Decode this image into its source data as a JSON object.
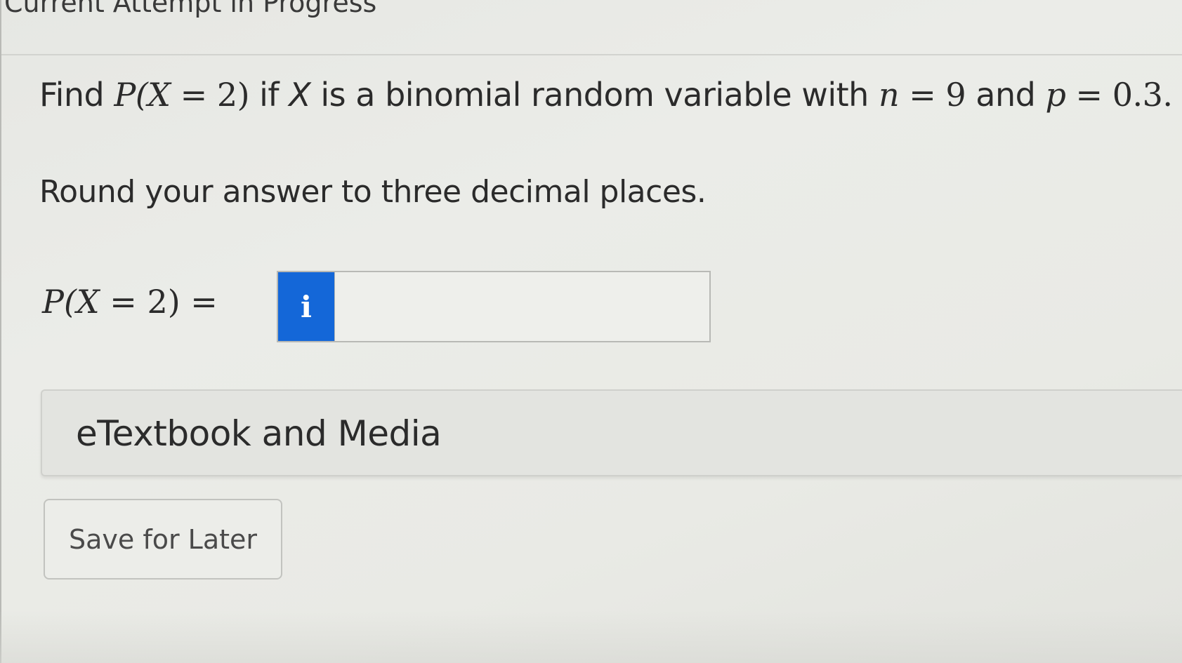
{
  "header": {
    "title": "Current Attempt in Progress"
  },
  "question": {
    "text_find": "Find ",
    "math_p_prefix": "P(",
    "math_x": "X",
    "math_eq_2": " = 2)",
    "text_if": " if ",
    "text_var_x": "X",
    "text_middle": " is a binomial random variable with ",
    "math_n": "n",
    "math_n_val": " = 9",
    "text_and": " and ",
    "math_p": "p",
    "math_p_val": " = 0.3."
  },
  "instruction": "Round your answer to three decimal places.",
  "answer": {
    "label_prefix": "P(",
    "label_x": "X",
    "label_suffix": " = 2)  =",
    "info_icon": "i",
    "value": ""
  },
  "media": {
    "label": "eTextbook and Media"
  },
  "actions": {
    "save_label": "Save for Later"
  },
  "colors": {
    "info_badge": "#1467d8",
    "background": "#e9eae5"
  }
}
